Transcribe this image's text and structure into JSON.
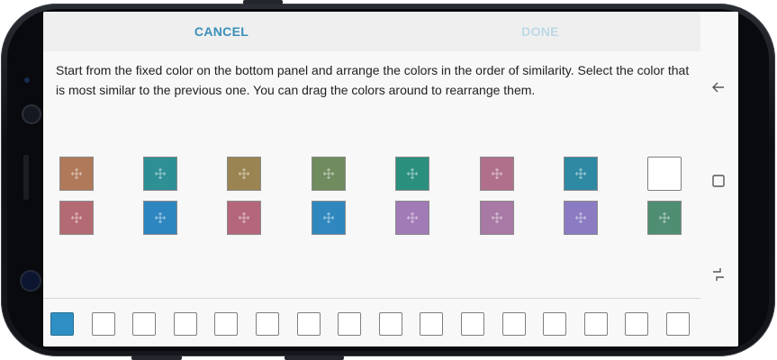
{
  "header": {
    "cancel_label": "CANCEL",
    "done_label": "DONE"
  },
  "instructions": "Start from the fixed color on the bottom panel and arrange the colors in the order of similarity. Select the color that is most similar to the previous one. You can drag the colors around to rearrange them.",
  "palette": {
    "row1": [
      "#b07a5a",
      "#2e8f95",
      "#9a8451",
      "#708b5e",
      "#2b8f7e",
      "#b0708c",
      "#2e89a3",
      "#ffffff"
    ],
    "row2": [
      "#b46a72",
      "#2e86c0",
      "#b4677a",
      "#2f87be",
      "#a17bb6",
      "#a879a4",
      "#8b7bc2",
      "#4f8e72"
    ]
  },
  "answer_slots": {
    "fixed_color": "#2e8fc4",
    "count": 16
  },
  "nav": {
    "icons": [
      "back-icon",
      "recent-apps-icon",
      "overview-icon"
    ]
  }
}
